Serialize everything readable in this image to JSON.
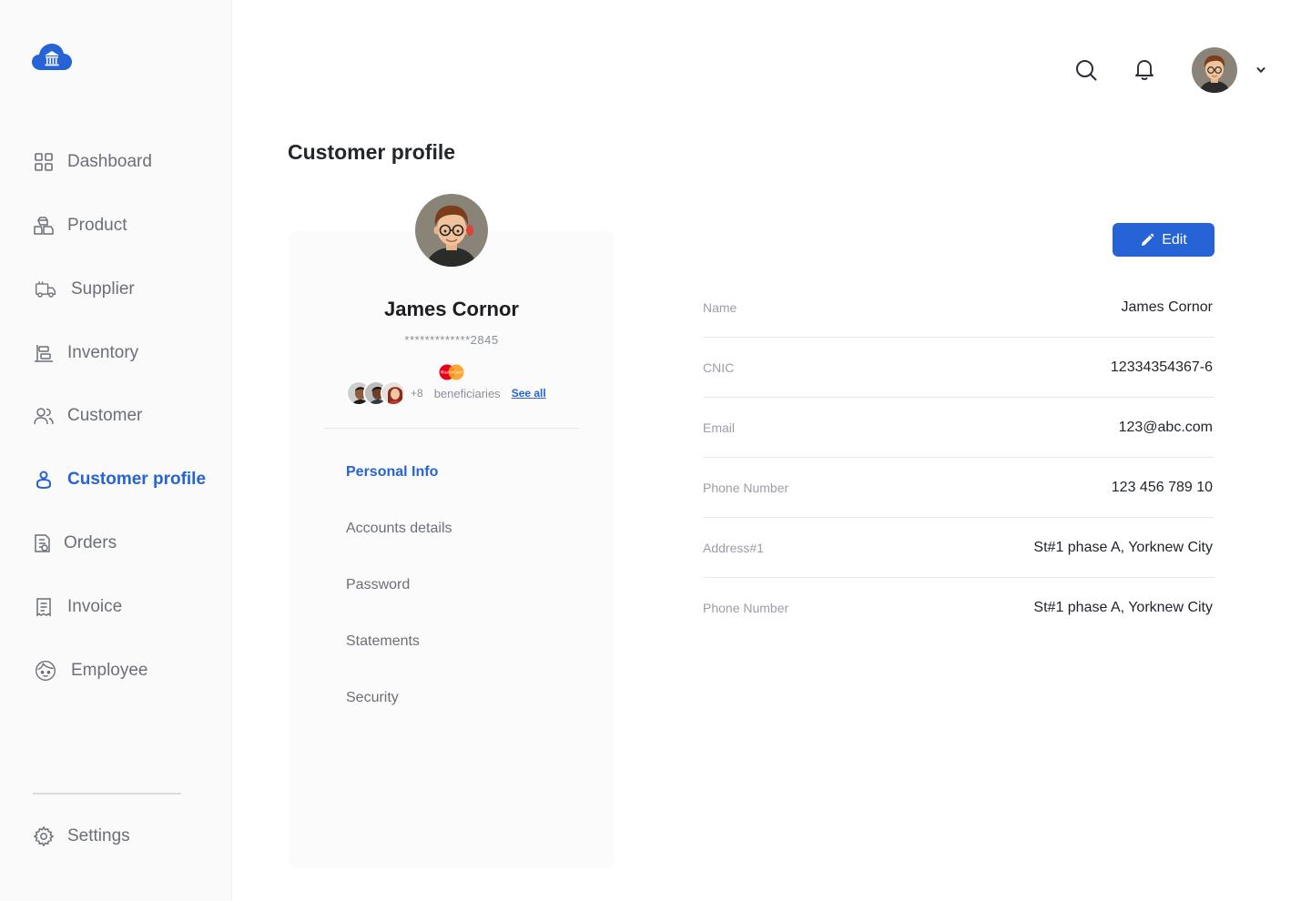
{
  "sidebar": {
    "items": [
      {
        "label": "Dashboard",
        "icon": "grid-icon"
      },
      {
        "label": "Product",
        "icon": "boxes-icon"
      },
      {
        "label": "Supplier",
        "icon": "truck-icon"
      },
      {
        "label": "Inventory",
        "icon": "inventory-icon"
      },
      {
        "label": "Customer",
        "icon": "users-icon"
      },
      {
        "label": "Customer profile",
        "icon": "user-icon"
      },
      {
        "label": "Orders",
        "icon": "orders-icon"
      },
      {
        "label": "Invoice",
        "icon": "invoice-icon"
      },
      {
        "label": "Employee",
        "icon": "face-icon"
      }
    ],
    "settings": {
      "label": "Settings",
      "icon": "gear-icon"
    }
  },
  "header": {
    "search_icon": "search-icon",
    "bell_icon": "bell-icon"
  },
  "page": {
    "title": "Customer profile"
  },
  "profile": {
    "name": "James Cornor",
    "card_number": "*************2845",
    "beneficiaries_count": "+8",
    "beneficiaries_label": "beneficiaries",
    "see_all": "See all",
    "mastercard_text": "MasterCard",
    "menu": [
      {
        "label": "Personal Info",
        "active": true
      },
      {
        "label": "Accounts details",
        "active": false
      },
      {
        "label": "Password",
        "active": false
      },
      {
        "label": "Statements",
        "active": false
      },
      {
        "label": "Security",
        "active": false
      }
    ]
  },
  "details": {
    "edit_label": "Edit",
    "rows": [
      {
        "label": "Name",
        "value": "James Cornor"
      },
      {
        "label": "CNIC",
        "value": "12334354367-6"
      },
      {
        "label": "Email",
        "value": "123@abc.com"
      },
      {
        "label": "Phone Number",
        "value": "123 456 789 10"
      },
      {
        "label": "Address#1",
        "value": "St#1 phase A, Yorknew City"
      },
      {
        "label": "Phone Number",
        "value": "St#1 phase A, Yorknew City"
      }
    ]
  },
  "colors": {
    "accent": "#2563d6",
    "sidebar_bg": "#fafafa",
    "muted_text": "#6b6f76"
  }
}
